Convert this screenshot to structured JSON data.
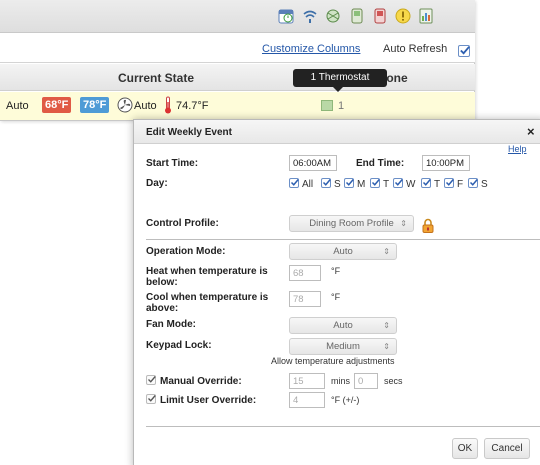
{
  "toolbar": {
    "icons": [
      "calendar-clock-icon",
      "wifi-icon",
      "network-icon",
      "device-icon",
      "alert-device-icon",
      "warning-icon",
      "report-icon"
    ]
  },
  "options": {
    "customize_columns": "Customize Columns",
    "auto_refresh": "Auto Refresh",
    "auto_refresh_checked": true
  },
  "table": {
    "col_current_state": "Current State",
    "col_zone_suffix": "s in Zone",
    "tooltip": "1 Thermostat",
    "row": {
      "mode": "Auto",
      "heat_setpoint": "68°F",
      "cool_setpoint": "78°F",
      "fan": "Auto",
      "temperature": "74.7°F",
      "zone_count": "1"
    }
  },
  "dialog": {
    "title": "Edit Weekly Event",
    "close": "×",
    "help": "Help",
    "start_time_label": "Start Time:",
    "start_time": "06:00AM",
    "end_time_label": "End Time:",
    "end_time": "10:00PM",
    "day_label": "Day:",
    "days": [
      {
        "label": "All",
        "checked": true
      },
      {
        "label": "S",
        "checked": true
      },
      {
        "label": "M",
        "checked": true
      },
      {
        "label": "T",
        "checked": true
      },
      {
        "label": "W",
        "checked": true
      },
      {
        "label": "T",
        "checked": true
      },
      {
        "label": "F",
        "checked": true
      },
      {
        "label": "S",
        "checked": true
      }
    ],
    "control_profile_label": "Control Profile:",
    "control_profile": "Dining Room Profile",
    "operation_mode_label": "Operation Mode:",
    "operation_mode": "Auto",
    "heat_label": "Heat when temperature is below:",
    "heat_value": "68",
    "heat_unit": "°F",
    "cool_label": "Cool when temperature is above:",
    "cool_value": "78",
    "cool_unit": "°F",
    "fan_mode_label": "Fan Mode:",
    "fan_mode": "Auto",
    "keypad_lock_label": "Keypad Lock:",
    "keypad_lock": "Medium",
    "keypad_note": "Allow temperature adjustments",
    "manual_override_label": "Manual Override:",
    "manual_override_checked": true,
    "manual_mins": "15",
    "mins_unit": "mins",
    "manual_secs": "0",
    "secs_unit": "secs",
    "limit_override_label": "Limit User Override:",
    "limit_override_checked": true,
    "limit_value": "4",
    "limit_unit": "°F (+/-)",
    "ok": "OK",
    "cancel": "Cancel"
  }
}
